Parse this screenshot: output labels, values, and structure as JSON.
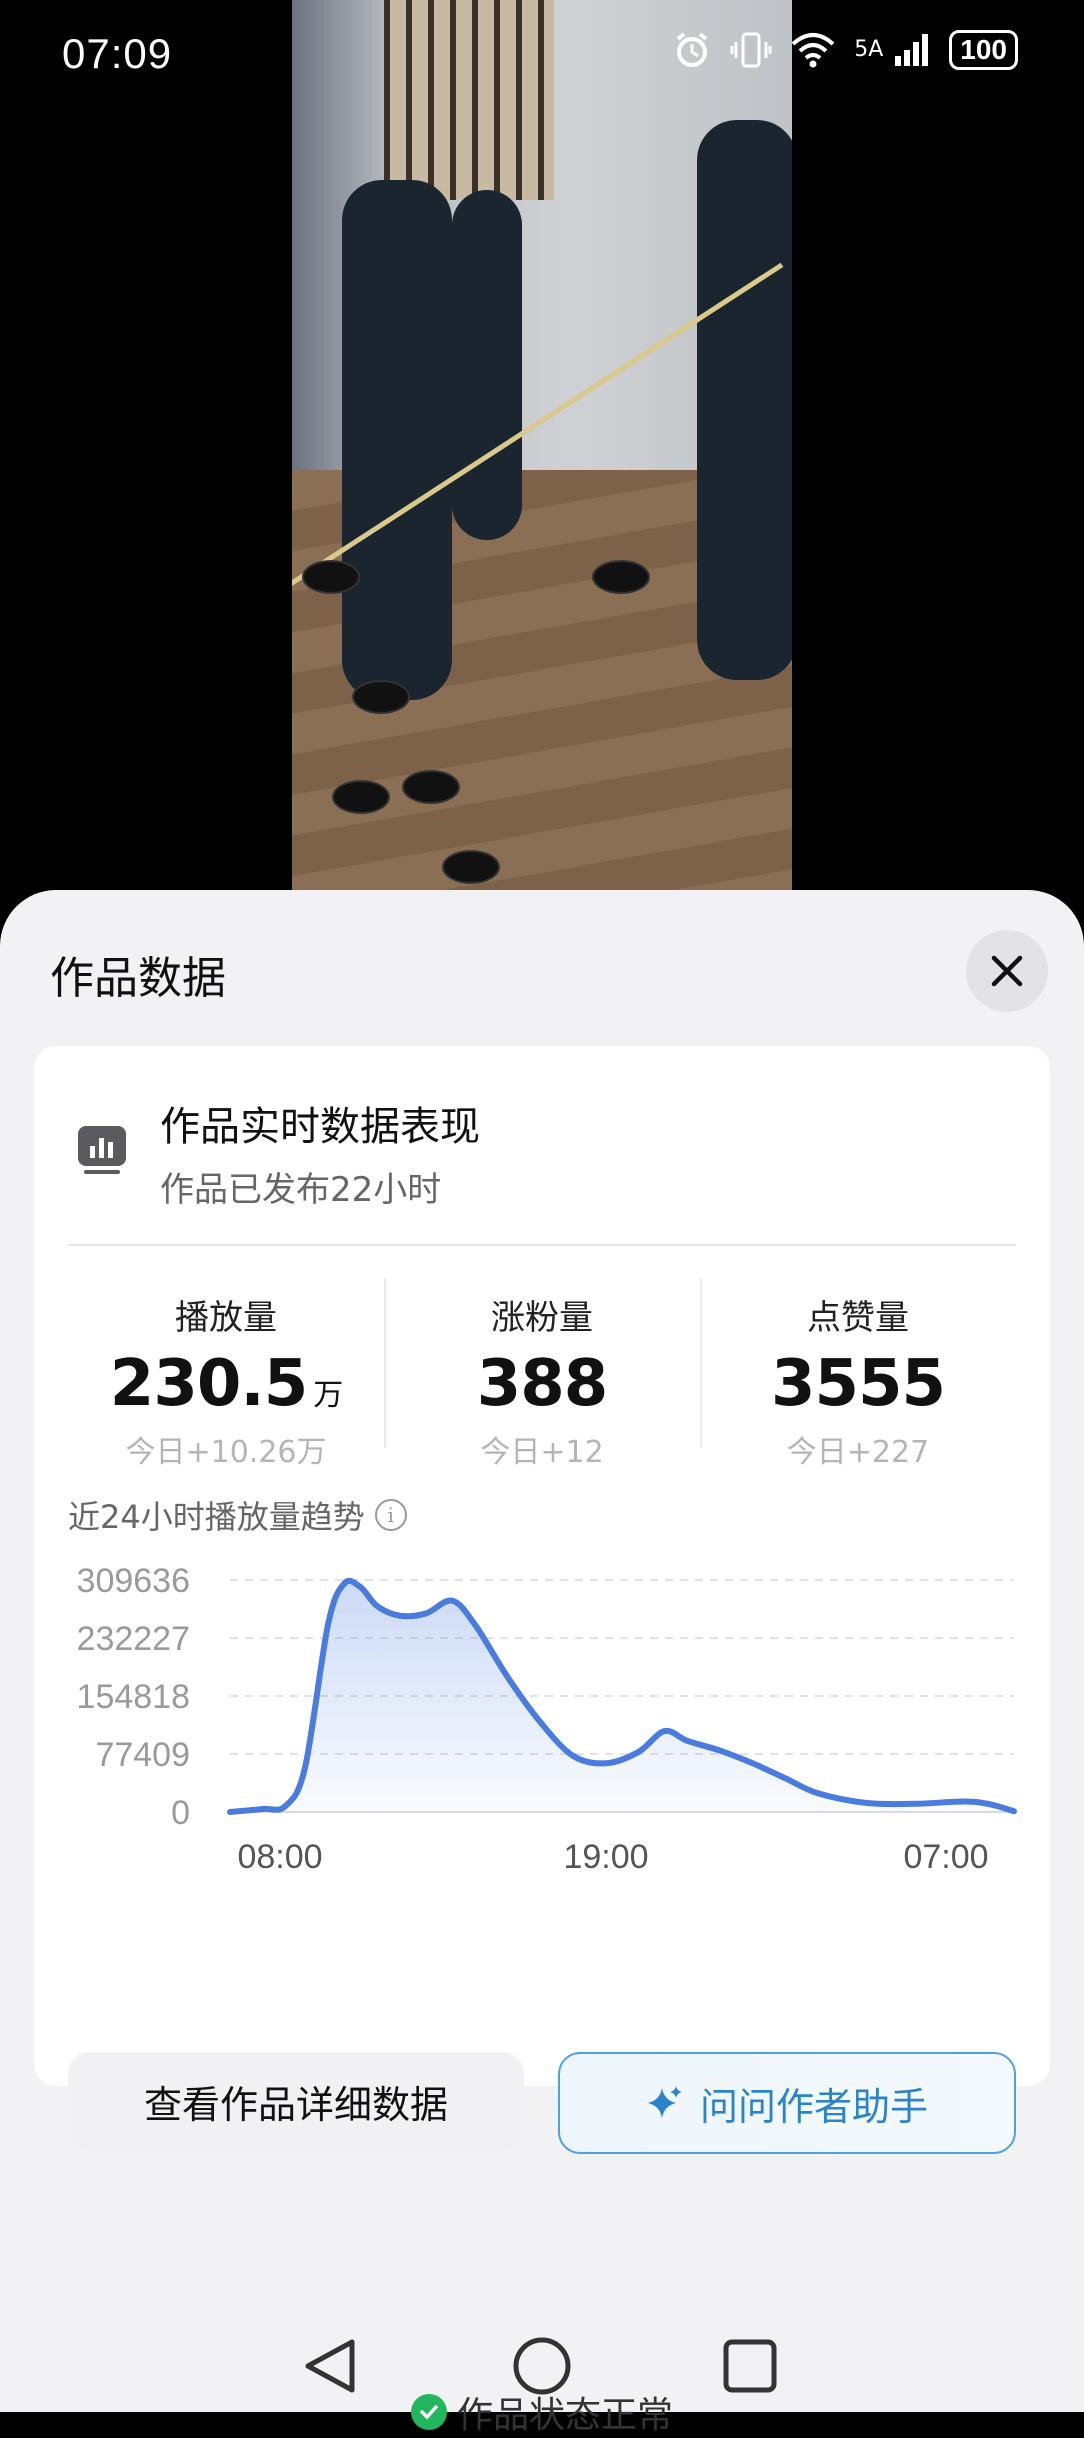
{
  "status_bar": {
    "time": "07:09",
    "network_label": "5A",
    "battery": "100",
    "icons": [
      "alarm-icon",
      "vibrate-icon",
      "wifi-icon",
      "cellular-signal-icon",
      "battery-icon"
    ]
  },
  "sheet": {
    "title": "作品数据",
    "close_icon": "close-icon"
  },
  "card": {
    "title": "作品实时数据表现",
    "subtitle": "作品已发布22小时",
    "icon": "chart-bar-icon",
    "metrics": [
      {
        "label": "播放量",
        "value": "230.5",
        "unit": "万",
        "delta": "今日+10.26万"
      },
      {
        "label": "涨粉量",
        "value": "388",
        "unit": "",
        "delta": "今日+12"
      },
      {
        "label": "点赞量",
        "value": "3555",
        "unit": "",
        "delta": "今日+227"
      }
    ],
    "trend_title": "近24小时播放量趋势",
    "buttons": {
      "detail": "查看作品详细数据",
      "assistant": "问问作者助手"
    }
  },
  "chart_data": {
    "type": "area",
    "title": "近24小时播放量趋势",
    "x_tick_labels": [
      "08:00",
      "19:00",
      "07:00"
    ],
    "y_tick_labels": [
      "309636",
      "232227",
      "154818",
      "77409",
      "0"
    ],
    "ylim": [
      0,
      309636
    ],
    "grid": true,
    "series": [
      {
        "color": "#4a7bde",
        "points": [
          {
            "x": 0,
            "y": 0
          },
          {
            "x": 1.0,
            "y": 4000
          },
          {
            "x": 1.7,
            "y": 8000
          },
          {
            "x": 2.3,
            "y": 60000
          },
          {
            "x": 3.0,
            "y": 250000
          },
          {
            "x": 3.5,
            "y": 305000
          },
          {
            "x": 4.0,
            "y": 300000
          },
          {
            "x": 4.5,
            "y": 275000
          },
          {
            "x": 5.2,
            "y": 262000
          },
          {
            "x": 6.0,
            "y": 265000
          },
          {
            "x": 6.8,
            "y": 282000
          },
          {
            "x": 7.5,
            "y": 250000
          },
          {
            "x": 8.5,
            "y": 180000
          },
          {
            "x": 9.5,
            "y": 120000
          },
          {
            "x": 10.5,
            "y": 75000
          },
          {
            "x": 11.5,
            "y": 65000
          },
          {
            "x": 12.5,
            "y": 80000
          },
          {
            "x": 13.3,
            "y": 108000
          },
          {
            "x": 14.0,
            "y": 95000
          },
          {
            "x": 15.0,
            "y": 82000
          },
          {
            "x": 16.0,
            "y": 65000
          },
          {
            "x": 17.0,
            "y": 45000
          },
          {
            "x": 18.0,
            "y": 25000
          },
          {
            "x": 19.5,
            "y": 12000
          },
          {
            "x": 21.0,
            "y": 11000
          },
          {
            "x": 22.5,
            "y": 14000
          },
          {
            "x": 23.3,
            "y": 10000
          },
          {
            "x": 24.0,
            "y": 1000
          }
        ]
      }
    ]
  },
  "status": {
    "text": "作品状态正常",
    "icon": "check-circle-icon"
  },
  "nav_bar": {
    "icons": [
      "back-icon",
      "home-icon",
      "recents-icon"
    ]
  }
}
